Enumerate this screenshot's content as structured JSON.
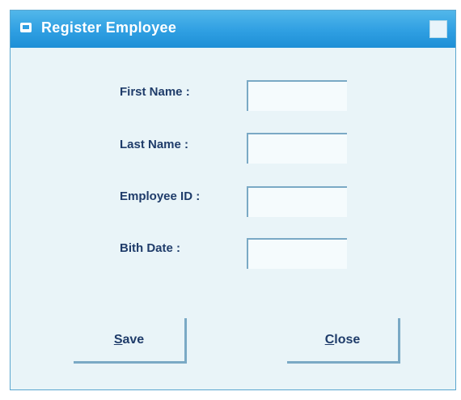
{
  "window": {
    "title": "Register Employee"
  },
  "form": {
    "fields": [
      {
        "label": "First Name :",
        "value": ""
      },
      {
        "label": "Last Name :",
        "value": ""
      },
      {
        "label": "Employee ID :",
        "value": ""
      },
      {
        "label": "Bith Date :",
        "value": ""
      }
    ]
  },
  "buttons": {
    "save": {
      "mnemonic": "S",
      "rest": "ave"
    },
    "close": {
      "mnemonic": "C",
      "rest": "lose"
    }
  },
  "colors": {
    "titlebar": "#2f9fe2",
    "window_background": "#e9f4f8",
    "label_text": "#1f3c6a",
    "border_accent": "#7aa9c5"
  },
  "icons": {
    "app": "window-app-icon",
    "title_button": "close-icon"
  }
}
